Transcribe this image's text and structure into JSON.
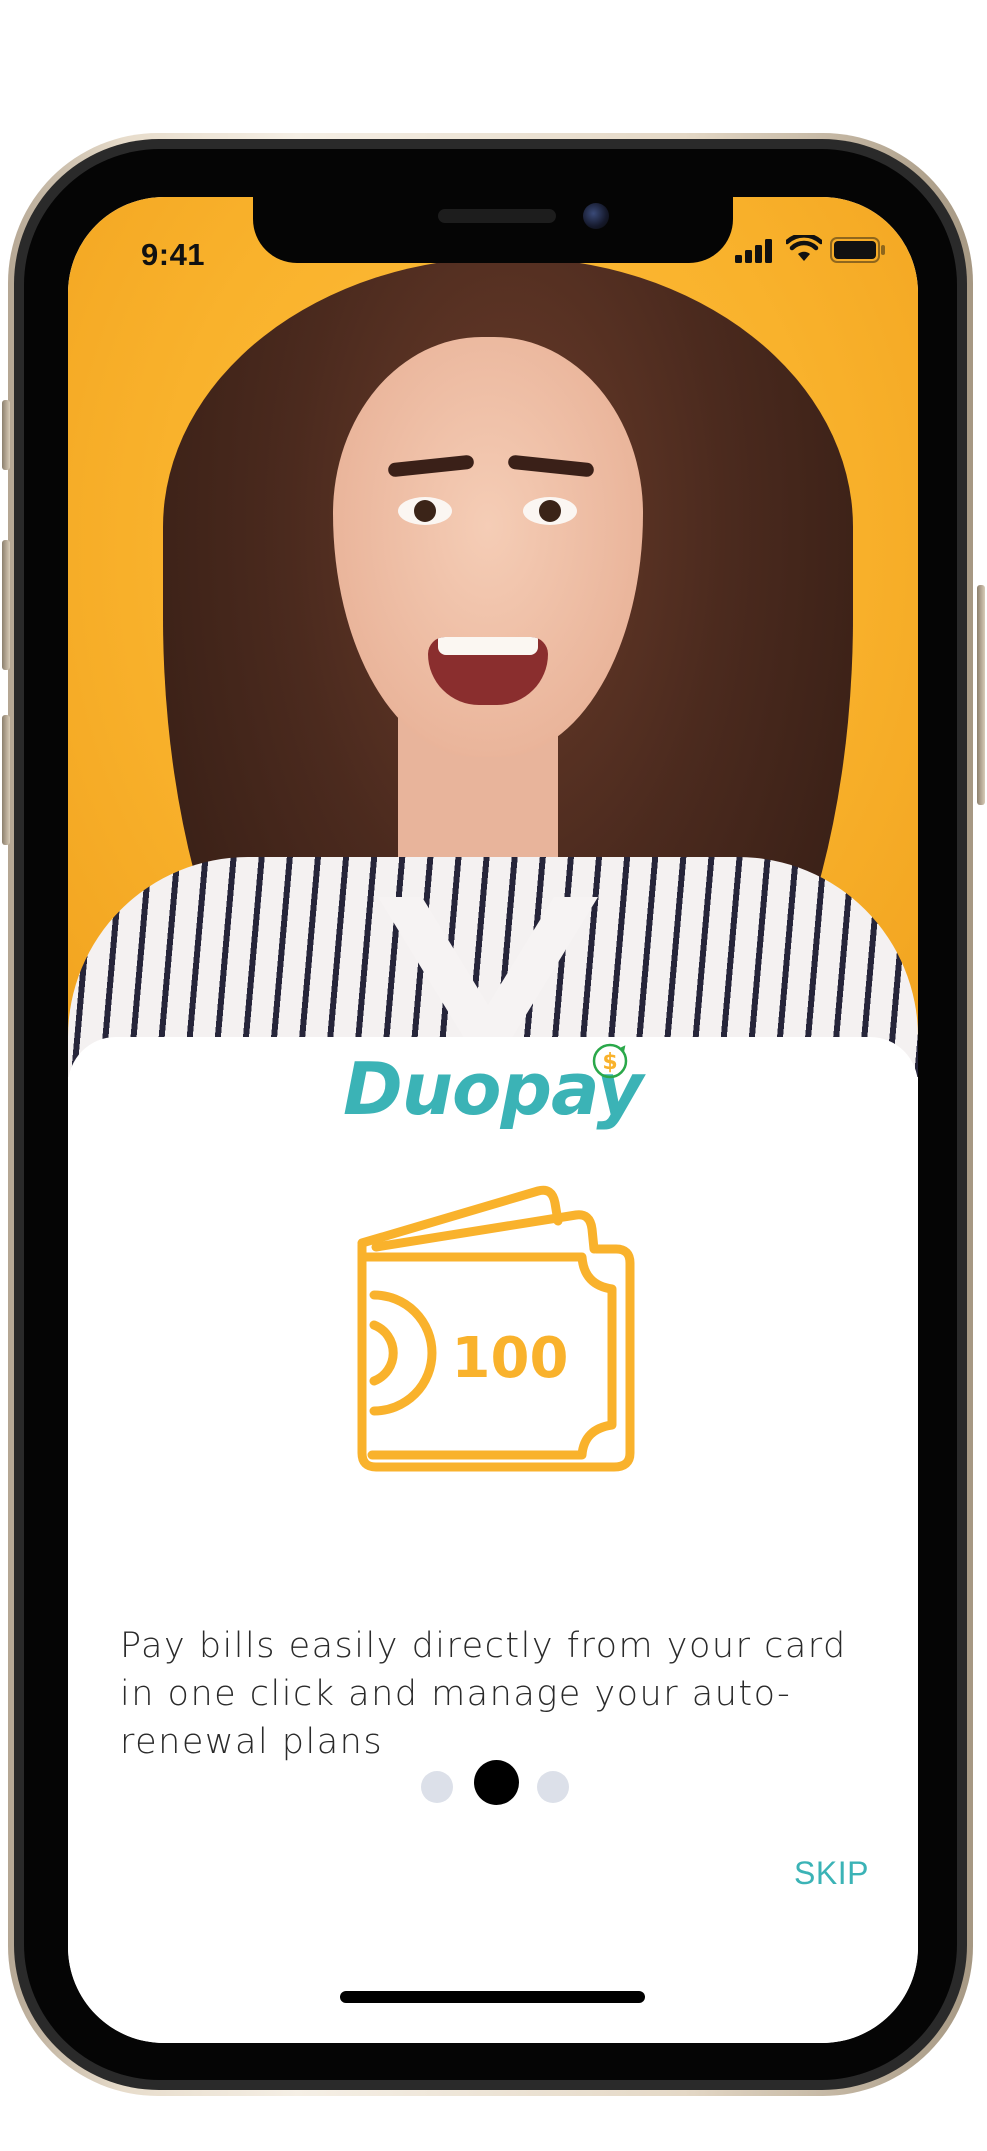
{
  "status_bar": {
    "time": "9:41",
    "icons": [
      "signal-icon",
      "wifi-icon",
      "battery-icon"
    ]
  },
  "hero": {
    "image": "smiling-woman-photo"
  },
  "brand": {
    "name": "Duopay",
    "coin_symbol": "$",
    "color": "#3bb3b6",
    "coin_color": "#f9b22c"
  },
  "illustration": {
    "icon": "wallet-banknote-icon",
    "banknote_value": "100",
    "color": "#f9b22c"
  },
  "onboarding": {
    "description": "Pay bills easily directly from your card in one click and manage your auto-renewal plans",
    "pages_total": 3,
    "current_page": 2,
    "skip_label": "SKIP"
  },
  "colors": {
    "hero_background": "#f9b22c",
    "accent": "#3bb3b6",
    "dot_inactive": "#dce0e9",
    "dot_active": "#000000"
  }
}
